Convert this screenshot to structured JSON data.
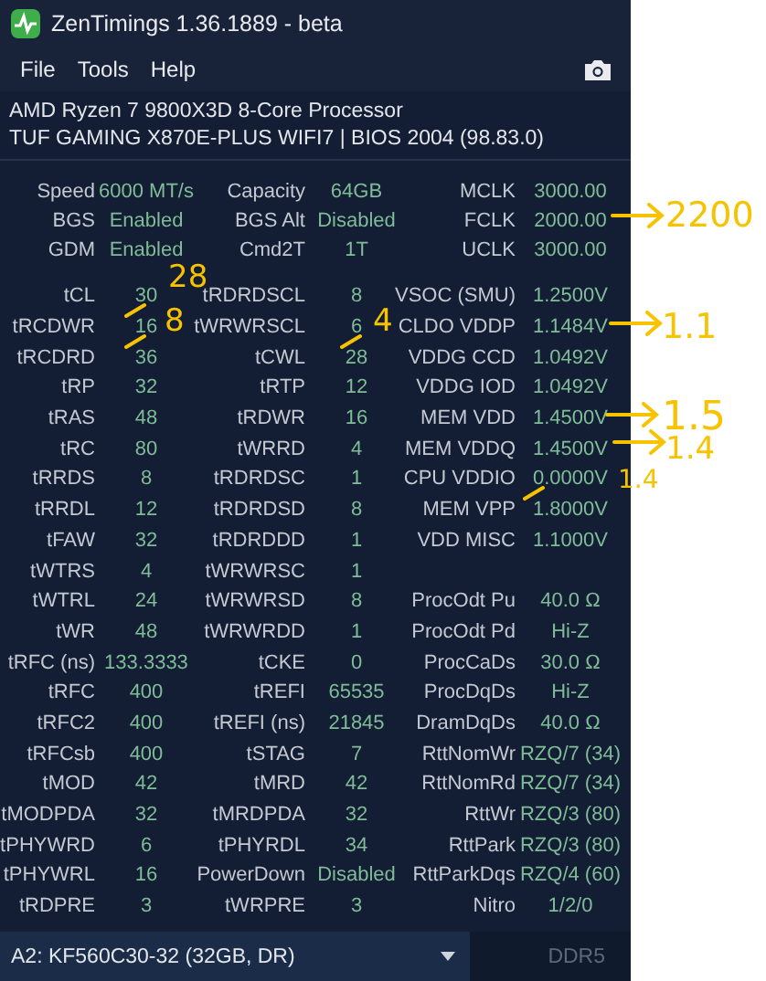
{
  "window": {
    "title": "ZenTimings 1.36.1889 - beta"
  },
  "menu": [
    "File",
    "Tools",
    "Help"
  ],
  "system": {
    "cpu": "AMD Ryzen 7 9800X3D 8-Core Processor",
    "board": "TUF GAMING X870E-PLUS WIFI7 | BIOS 2004 (98.83.0)"
  },
  "summary": [
    [
      {
        "label": "Speed",
        "value": "6000 MT/s"
      },
      {
        "label": "Capacity",
        "value": "64GB"
      },
      {
        "label": "MCLK",
        "value": "3000.00"
      }
    ],
    [
      {
        "label": "BGS",
        "value": "Enabled"
      },
      {
        "label": "BGS Alt",
        "value": "Disabled"
      },
      {
        "label": "FCLK",
        "value": "2000.00"
      }
    ],
    [
      {
        "label": "GDM",
        "value": "Enabled"
      },
      {
        "label": "Cmd2T",
        "value": "1T"
      },
      {
        "label": "UCLK",
        "value": "3000.00"
      }
    ]
  ],
  "timings": [
    [
      {
        "label": "tCL",
        "value": "30",
        "struck": true
      },
      {
        "label": "tRDRDSCL",
        "value": "8"
      },
      {
        "label": "VSOC (SMU)",
        "value": "1.2500V"
      }
    ],
    [
      {
        "label": "tRCDWR",
        "value": "16",
        "struck": true
      },
      {
        "label": "tWRWRSCL",
        "value": "6",
        "struck": true
      },
      {
        "label": "CLDO VDDP",
        "value": "1.1484V"
      }
    ],
    [
      {
        "label": "tRCDRD",
        "value": "36"
      },
      {
        "label": "tCWL",
        "value": "28"
      },
      {
        "label": "VDDG CCD",
        "value": "1.0492V"
      }
    ],
    [
      {
        "label": "tRP",
        "value": "32"
      },
      {
        "label": "tRTP",
        "value": "12"
      },
      {
        "label": "VDDG IOD",
        "value": "1.0492V"
      }
    ],
    [
      {
        "label": "tRAS",
        "value": "48"
      },
      {
        "label": "tRDWR",
        "value": "16"
      },
      {
        "label": "MEM VDD",
        "value": "1.4500V"
      }
    ],
    [
      {
        "label": "tRC",
        "value": "80"
      },
      {
        "label": "tWRRD",
        "value": "4"
      },
      {
        "label": "MEM VDDQ",
        "value": "1.4500V"
      }
    ],
    [
      {
        "label": "tRRDS",
        "value": "8"
      },
      {
        "label": "tRDRDSC",
        "value": "1"
      },
      {
        "label": "CPU VDDIO",
        "value": "0.0000V",
        "struck": true
      }
    ],
    [
      {
        "label": "tRRDL",
        "value": "12"
      },
      {
        "label": "tRDRDSD",
        "value": "8"
      },
      {
        "label": "MEM VPP",
        "value": "1.8000V"
      }
    ],
    [
      {
        "label": "tFAW",
        "value": "32"
      },
      {
        "label": "tRDRDDD",
        "value": "1"
      },
      {
        "label": "VDD MISC",
        "value": "1.1000V"
      }
    ],
    [
      {
        "label": "tWTRS",
        "value": "4"
      },
      {
        "label": "tWRWRSC",
        "value": "1"
      }
    ],
    [
      {
        "label": "tWTRL",
        "value": "24"
      },
      {
        "label": "tWRWRSD",
        "value": "8"
      },
      {
        "label": "ProcOdt Pu",
        "value": "40.0 Ω"
      }
    ],
    [
      {
        "label": "tWR",
        "value": "48"
      },
      {
        "label": "tWRWRDD",
        "value": "1"
      },
      {
        "label": "ProcOdt Pd",
        "value": "Hi-Z"
      }
    ],
    [
      {
        "label": "tRFC (ns)",
        "value": "133.3333"
      },
      {
        "label": "tCKE",
        "value": "0"
      },
      {
        "label": "ProcCaDs",
        "value": "30.0 Ω"
      }
    ],
    [
      {
        "label": "tRFC",
        "value": "400"
      },
      {
        "label": "tREFI",
        "value": "65535"
      },
      {
        "label": "ProcDqDs",
        "value": "Hi-Z"
      }
    ],
    [
      {
        "label": "tRFC2",
        "value": "400"
      },
      {
        "label": "tREFI (ns)",
        "value": "21845"
      },
      {
        "label": "DramDqDs",
        "value": "40.0 Ω"
      }
    ],
    [
      {
        "label": "tRFCsb",
        "value": "400"
      },
      {
        "label": "tSTAG",
        "value": "7"
      },
      {
        "label": "RttNomWr",
        "value": "RZQ/7 (34)"
      }
    ],
    [
      {
        "label": "tMOD",
        "value": "42"
      },
      {
        "label": "tMRD",
        "value": "42"
      },
      {
        "label": "RttNomRd",
        "value": "RZQ/7 (34)"
      }
    ],
    [
      {
        "label": "tMODPDA",
        "value": "32"
      },
      {
        "label": "tMRDPDA",
        "value": "32"
      },
      {
        "label": "RttWr",
        "value": "RZQ/3 (80)"
      }
    ],
    [
      {
        "label": "tPHYWRD",
        "value": "6"
      },
      {
        "label": "tPHYRDL",
        "value": "34"
      },
      {
        "label": "RttPark",
        "value": "RZQ/3 (80)"
      }
    ],
    [
      {
        "label": "tPHYWRL",
        "value": "16"
      },
      {
        "label": "PowerDown",
        "value": "Disabled"
      },
      {
        "label": "RttParkDqs",
        "value": "RZQ/4 (60)"
      }
    ],
    [
      {
        "label": "tRDPRE",
        "value": "3"
      },
      {
        "label": "tWRPRE",
        "value": "3"
      },
      {
        "label": "Nitro",
        "value": "1/2/0"
      }
    ]
  ],
  "module": {
    "value": "A2: KF560C30-32 (32GB, DR)"
  },
  "memory_type": "DDR5",
  "annotations": [
    {
      "kind": "note",
      "text": "28"
    },
    {
      "kind": "note",
      "text": "8"
    },
    {
      "kind": "note",
      "text": "4"
    },
    {
      "kind": "arrow",
      "text": "2200"
    },
    {
      "kind": "arrow",
      "text": "1.1"
    },
    {
      "kind": "arrow",
      "text": "1.5"
    },
    {
      "kind": "arrow",
      "text": "1.4"
    },
    {
      "kind": "note",
      "text": "1.4"
    }
  ]
}
